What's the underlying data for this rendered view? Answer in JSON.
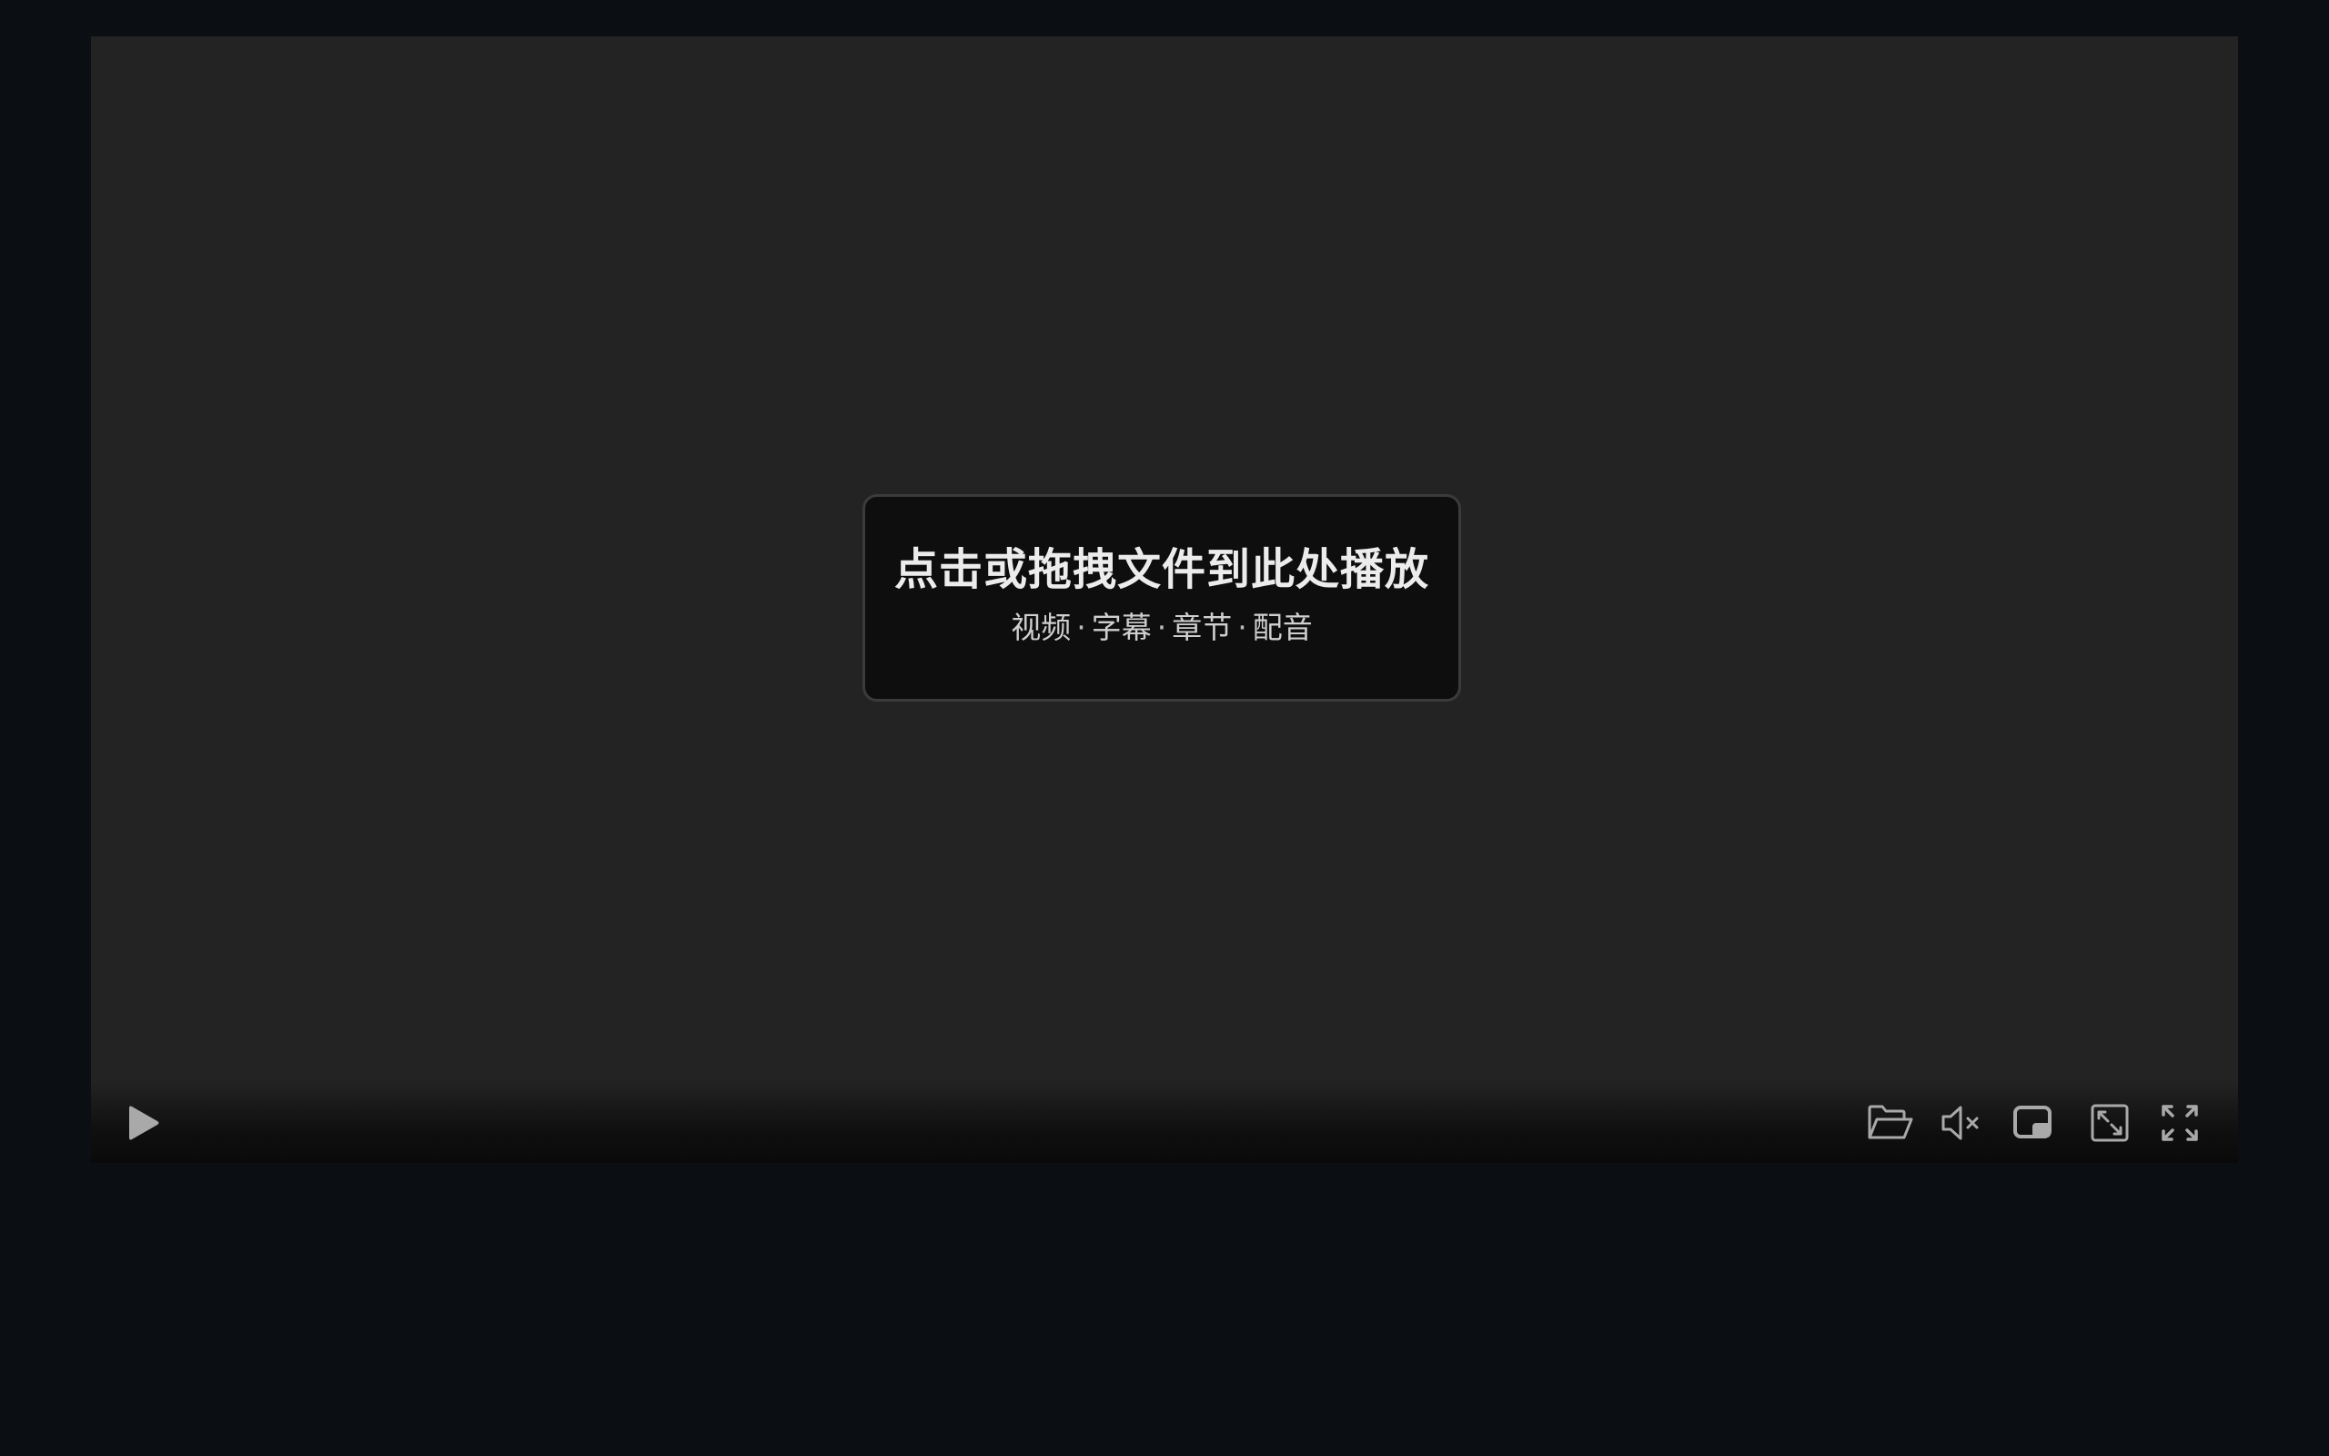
{
  "drop_zone": {
    "title": "点击或拖拽文件到此处播放",
    "types": [
      "视频",
      "字幕",
      "章节",
      "配音"
    ],
    "separator": "·"
  },
  "controls": {
    "play": {
      "icon": "play-icon"
    },
    "open_file": {
      "icon": "folder-open-icon"
    },
    "volume": {
      "icon": "volume-muted-icon",
      "muted": true
    },
    "pip": {
      "icon": "picture-in-picture-icon"
    },
    "web_fullscreen": {
      "icon": "expand-window-icon"
    },
    "fullscreen": {
      "icon": "fullscreen-icon"
    }
  },
  "colors": {
    "page_background": "#0b0e13",
    "player_background": "#232323",
    "panel_background": "#0e0e0e",
    "panel_border": "#3b3b3b",
    "icon": "#a9a9a9",
    "title_text": "#ececec"
  }
}
